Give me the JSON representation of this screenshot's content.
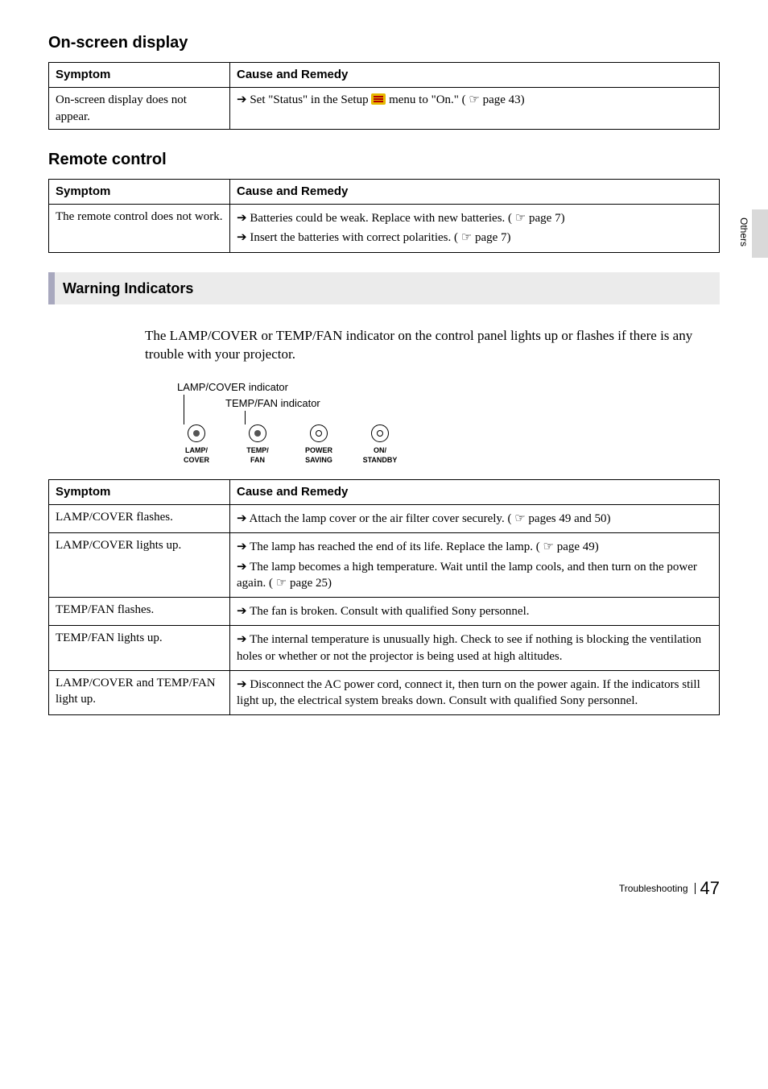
{
  "side_tab": "Others",
  "sections": {
    "osd": {
      "title": "On-screen display",
      "th1": "Symptom",
      "th2": "Cause and Remedy",
      "row": {
        "symptom": "On-screen display does not appear.",
        "remedy_pre": "Set \"Status\" in the Setup ",
        "remedy_post": " menu to \"On.\" (",
        "remedy_ref": " page 43)"
      }
    },
    "remote": {
      "title": "Remote control",
      "th1": "Symptom",
      "th2": "Cause and Remedy",
      "row": {
        "symptom": "The remote control does not work.",
        "r1_pre": "Batteries could be weak. Replace with new batteries. (",
        "r1_ref": " page 7)",
        "r2_pre": "Insert the batteries with correct polarities. (",
        "r2_ref": " page 7)"
      }
    }
  },
  "warning": {
    "heading": "Warning Indicators",
    "intro": "The LAMP/COVER or TEMP/FAN indicator on the control panel lights up or flashes if there is any trouble with your projector.",
    "lbl_lampcover": "LAMP/COVER indicator",
    "lbl_tempfan": "TEMP/FAN indicator",
    "icons": {
      "lamp": "LAMP/\nCOVER",
      "temp": "TEMP/\nFAN",
      "power": "POWER\nSAVING",
      "standby": "ON/\nSTANDBY"
    },
    "table": {
      "th1": "Symptom",
      "th2": "Cause and Remedy",
      "rows": [
        {
          "s": "LAMP/COVER flashes.",
          "items": [
            {
              "pre": "Attach the lamp cover or the air filter cover securely. (",
              "ref": " pages 49 and 50)"
            }
          ]
        },
        {
          "s": "LAMP/COVER lights up.",
          "items": [
            {
              "pre": "The lamp has reached the end of its life. Replace the lamp. (",
              "ref": " page 49)"
            },
            {
              "pre": "The lamp becomes a high temperature. Wait until the lamp cools, and then turn on the power again. (",
              "ref": " page 25)"
            }
          ]
        },
        {
          "s": "TEMP/FAN flashes.",
          "items": [
            {
              "plain": "The fan is broken. Consult with qualified Sony personnel."
            }
          ]
        },
        {
          "s": "TEMP/FAN lights up.",
          "items": [
            {
              "plain": "The internal temperature is unusually high. Check to see if nothing is blocking the ventilation holes or whether or not the projector is being used at high altitudes."
            }
          ]
        },
        {
          "s": "LAMP/COVER and TEMP/FAN light up.",
          "items": [
            {
              "plain": "Disconnect the AC power cord, connect it, then turn on the power again. If the indicators still light up, the electrical system breaks down. Consult with qualified Sony personnel."
            }
          ]
        }
      ]
    }
  },
  "footer": {
    "title": "Troubleshooting",
    "page": "47"
  }
}
